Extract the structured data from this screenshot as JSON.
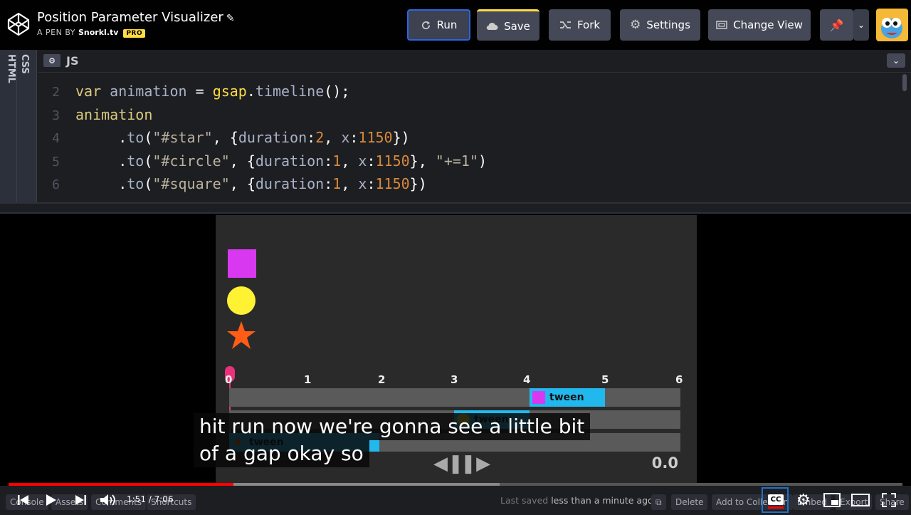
{
  "header": {
    "title": "Position Parameter Visualizer",
    "byline_prefix": "A PEN BY",
    "author": "Snorkl.tv",
    "badge": "PRO",
    "buttons": {
      "run": "Run",
      "save": "Save",
      "fork": "Fork",
      "settings": "Settings",
      "change_view": "Change View"
    },
    "accent": "#2767e1",
    "save_accent": "#ffdd40"
  },
  "editor": {
    "side_tabs": [
      "HTML",
      "CSS"
    ],
    "panel_label": "JS",
    "lines": [
      {
        "num": "2",
        "tokens": [
          [
            "v",
            "var "
          ],
          [
            "f",
            "animation "
          ],
          [
            "p",
            "= "
          ],
          [
            "fn",
            "gsap"
          ],
          [
            "p",
            "."
          ],
          [
            "f",
            "timeline"
          ],
          [
            "p",
            "();"
          ]
        ]
      },
      {
        "num": "3",
        "tokens": [
          [
            "k",
            "animation"
          ]
        ]
      },
      {
        "num": "4",
        "tokens": [
          [
            "p",
            "     ."
          ],
          [
            "f",
            "to"
          ],
          [
            "p",
            "("
          ],
          [
            "s",
            "\"#star\""
          ],
          [
            "p",
            ", {"
          ],
          [
            "f",
            "duration"
          ],
          [
            "p",
            ":"
          ],
          [
            "n",
            "2"
          ],
          [
            "p",
            ", "
          ],
          [
            "f",
            "x"
          ],
          [
            "p",
            ":"
          ],
          [
            "n",
            "1150"
          ],
          [
            "p",
            "})"
          ]
        ]
      },
      {
        "num": "5",
        "tokens": [
          [
            "p",
            "     ."
          ],
          [
            "f",
            "to"
          ],
          [
            "p",
            "("
          ],
          [
            "s",
            "\"#circle\""
          ],
          [
            "p",
            ", {"
          ],
          [
            "f",
            "duration"
          ],
          [
            "p",
            ":"
          ],
          [
            "n",
            "1"
          ],
          [
            "p",
            ", "
          ],
          [
            "f",
            "x"
          ],
          [
            "p",
            ":"
          ],
          [
            "n",
            "1150"
          ],
          [
            "p",
            "}, "
          ],
          [
            "s",
            "\"+=1\""
          ],
          [
            "p",
            ")"
          ]
        ]
      },
      {
        "num": "6",
        "tokens": [
          [
            "p",
            "     ."
          ],
          [
            "f",
            "to"
          ],
          [
            "p",
            "("
          ],
          [
            "s",
            "\"#square\""
          ],
          [
            "p",
            ", {"
          ],
          [
            "f",
            "duration"
          ],
          [
            "p",
            ":"
          ],
          [
            "n",
            "1"
          ],
          [
            "p",
            ", "
          ],
          [
            "f",
            "x"
          ],
          [
            "p",
            ":"
          ],
          [
            "n",
            "1150"
          ],
          [
            "p",
            "})"
          ]
        ]
      }
    ]
  },
  "preview": {
    "ticks": [
      "0",
      "1",
      "2",
      "3",
      "4",
      "5",
      "6"
    ],
    "tween_label": "tween",
    "time_readout": "0.0",
    "shape_colors": {
      "square": "#d839f0",
      "circle": "#fff233",
      "star": "#ff5d16"
    },
    "tween_color": "#21b8ee",
    "playhead_color": "#e8327c"
  },
  "captions": [
    "hit run now we're gonna see a little bit",
    "of a gap okay so"
  ],
  "video": {
    "current_time": "1:51",
    "duration": "7:06",
    "progress": 0.2515
  },
  "bottombar": {
    "console": "Console",
    "assets": "Assets",
    "comments": "Comments",
    "shortcuts": "Shortcuts",
    "last_saved_prefix": "Last saved",
    "last_saved_value": "less than a minute ago",
    "delete": "Delete",
    "add_to_collection": "Add to Collection",
    "embed": "Embed",
    "export": "Export",
    "share": "Share",
    "cc": "CC"
  }
}
